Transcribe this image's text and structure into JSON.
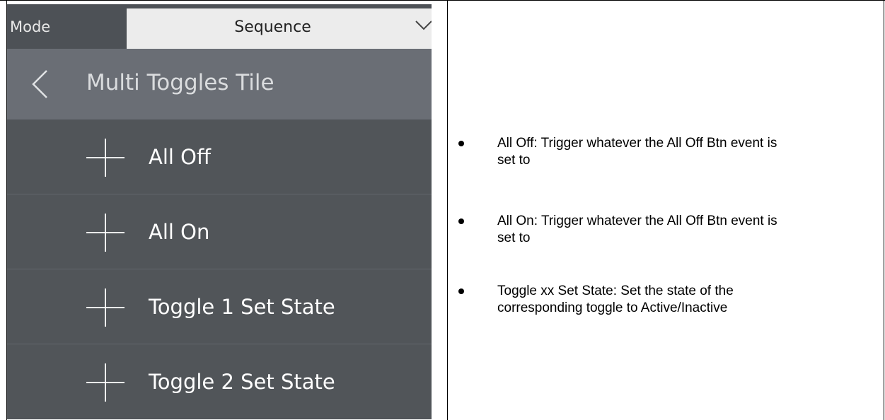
{
  "panel": {
    "mode_label": "Mode",
    "mode_value": "Sequence",
    "title": "Multi Toggles Tile",
    "items": [
      {
        "label": "All Off"
      },
      {
        "label": "All On"
      },
      {
        "label": "Toggle 1 Set State"
      },
      {
        "label": "Toggle 2 Set State"
      }
    ]
  },
  "notes": [
    "All Off: Trigger whatever the All Off Btn event is set to",
    "All On: Trigger whatever the All Off Btn event is set to",
    "Toggle xx Set State: Set the state of the corresponding toggle to Active/Inactive"
  ],
  "colors": {
    "panel_bg": "#515559",
    "title_bar": "#6a6e75",
    "select_bg": "#ececec"
  }
}
